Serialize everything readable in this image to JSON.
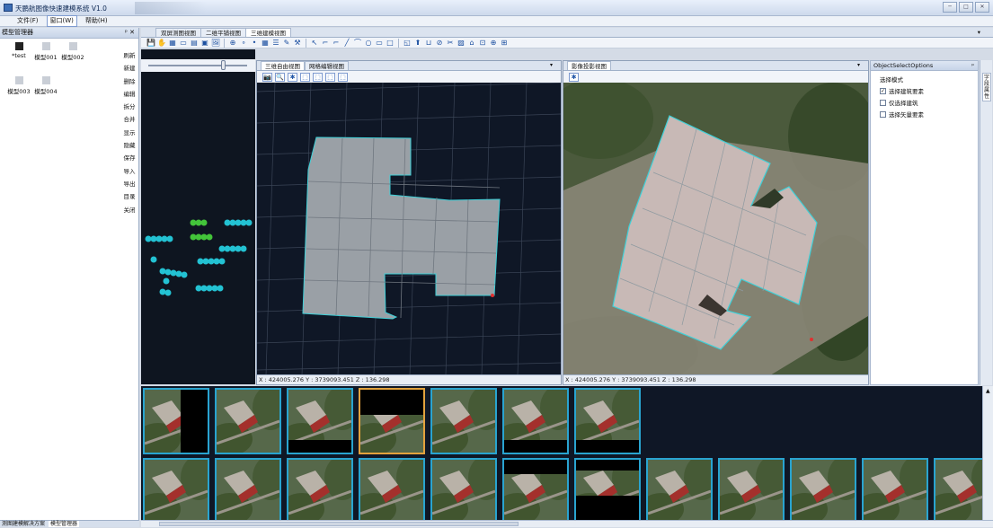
{
  "window": {
    "title": "天鹏航图像快速建模系统 V1.0",
    "controls": [
      "─",
      "□",
      "✕"
    ]
  },
  "menu": [
    {
      "label": "文件(F)",
      "active": false
    },
    {
      "label": "窗口(W)",
      "active": true
    },
    {
      "label": "帮助(H)",
      "active": false
    }
  ],
  "left_panel": {
    "title": "模型管理器",
    "pin": "ᵖ ✕",
    "models": [
      {
        "label": "*test",
        "dark": true
      },
      {
        "label": "模型001",
        "dark": false
      },
      {
        "label": "模型002",
        "dark": false
      },
      {
        "label": "模型003",
        "dark": false
      },
      {
        "label": "模型004",
        "dark": false
      }
    ],
    "commands": [
      "刷新",
      "新建",
      "删除",
      "编辑",
      "拆分",
      "合并",
      "显示",
      "隐藏",
      "保存",
      "导入",
      "导出",
      "目录",
      "关闭"
    ]
  },
  "bottom_tabs": [
    {
      "label": "测图建模解决方案",
      "active": false
    },
    {
      "label": "模型管理器",
      "active": true
    }
  ],
  "main_tabs": [
    {
      "label": "双屏测图视图",
      "active": false
    },
    {
      "label": "二维平铺视图",
      "active": false
    },
    {
      "label": "三维建模视图",
      "active": true
    }
  ],
  "toolbar_icons": [
    "save-icon",
    "hand-icon",
    "grid-icon",
    "window-icon",
    "layout-icon",
    "panel-icon",
    "image-icon",
    "globe-icon",
    "node-icon",
    "vertex-icon",
    "tile-icon",
    "layer-icon",
    "edit-icon",
    "wrench-icon",
    "arrow-icon",
    "polyline-icon",
    "corner-icon",
    "line-icon",
    "arc-icon",
    "circle-icon",
    "rect-icon",
    "square-icon",
    "face-icon",
    "extrude-icon",
    "merge-icon",
    "split-icon",
    "cut-icon",
    "texture-icon",
    "roof-icon",
    "frame-icon",
    "zoom-icon",
    "fit-icon"
  ],
  "slider": {
    "value_fraction": 0.75
  },
  "view_a": {
    "tabs": [
      {
        "label": "三维自由视图",
        "active": true
      },
      {
        "label": "网格编辑视图",
        "active": false
      }
    ],
    "tool_glyphs": [
      "📷",
      "🔍",
      "✱",
      "⬚",
      "⬚",
      "⬚",
      "⬚"
    ],
    "coord": "X : 424005.276 Y : 3739093.451 Z : 136.298"
  },
  "view_b": {
    "tabs": [
      {
        "label": "影像投影视图",
        "active": true
      }
    ],
    "coord": "X : 424005.276 Y : 3739093.451 Z : 136.298"
  },
  "options": {
    "title": "ObjectSelectOptions",
    "group": "选择模式",
    "items": [
      {
        "label": "选择建筑要素",
        "checked": true
      },
      {
        "label": "仅选择建筑",
        "checked": false
      },
      {
        "label": "选择矢量要素",
        "checked": false
      }
    ],
    "side_tab": "字段属性"
  },
  "thumbnails": {
    "selected_index": 3,
    "row1_count": 7,
    "row2_count": 12
  },
  "colors": {
    "accent": "#29a4d0",
    "selected_thumb": "#e3a23d",
    "building_outline": "#3fd0d8",
    "scene_bg": "#0f1726"
  }
}
